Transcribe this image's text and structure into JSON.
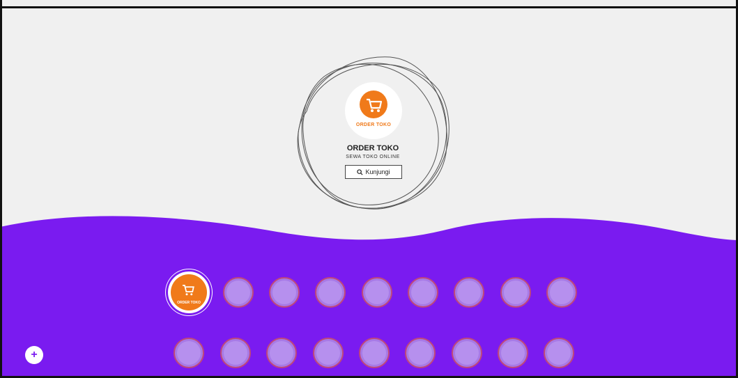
{
  "hero": {
    "brand_text": "ORDER TOKO",
    "title": "ORDER TOKO",
    "subtitle": "SEWA TOKO ONLINE",
    "visit_label": "Kunjungi",
    "visit_icon": "search-icon"
  },
  "apps_row1": [
    {
      "name": "order-toko",
      "label": "ORDER TOKO",
      "active": true
    },
    {
      "name": "app-2",
      "label": ""
    },
    {
      "name": "app-3",
      "label": ""
    },
    {
      "name": "app-4",
      "label": ""
    },
    {
      "name": "app-5",
      "label": ""
    },
    {
      "name": "app-6",
      "label": ""
    },
    {
      "name": "app-7",
      "label": ""
    },
    {
      "name": "app-8",
      "label": ""
    },
    {
      "name": "app-9",
      "label": ""
    }
  ],
  "apps_row2": [
    {
      "name": "app-10",
      "label": ""
    },
    {
      "name": "app-11",
      "label": ""
    },
    {
      "name": "app-12",
      "label": ""
    },
    {
      "name": "app-13",
      "label": ""
    },
    {
      "name": "app-14",
      "label": ""
    },
    {
      "name": "app-15",
      "label": ""
    },
    {
      "name": "app-16",
      "label": ""
    },
    {
      "name": "app-17",
      "label": ""
    },
    {
      "name": "app-18",
      "label": ""
    }
  ],
  "plus_label": "+",
  "colors": {
    "wave": "#7a1bf0",
    "bg": "#f0f0f0",
    "brand": "#f07a1a"
  }
}
